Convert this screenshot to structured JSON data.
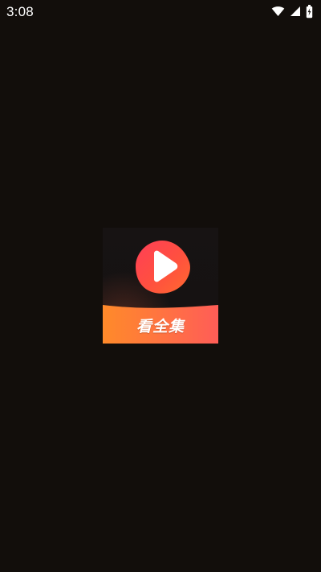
{
  "status_bar": {
    "time": "3:08",
    "icons": [
      "wifi-icon",
      "cellular-signal-icon",
      "battery-charging-icon"
    ]
  },
  "splash": {
    "logo_text": "看全集",
    "icon": "play-icon",
    "colors": {
      "background": "#120e0b",
      "play_red": "#ff3f55",
      "play_orange": "#ff6b32",
      "banner_orange": "#ff8a2a",
      "banner_pink": "#ff5d57"
    }
  }
}
